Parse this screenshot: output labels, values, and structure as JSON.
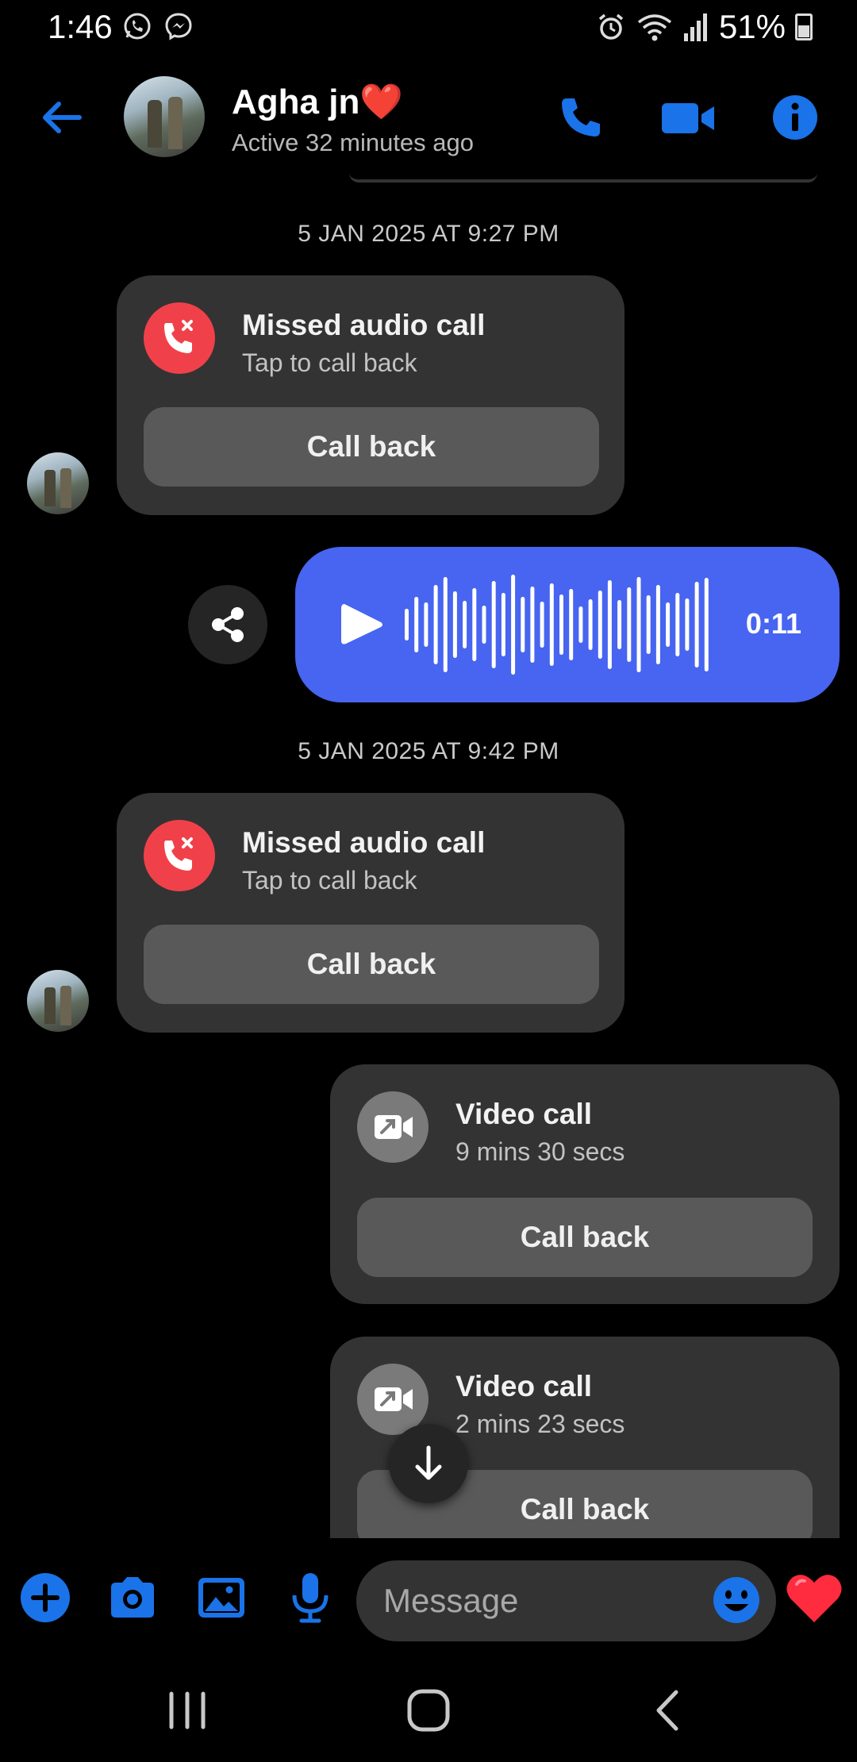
{
  "status_bar": {
    "time": "1:46",
    "battery": "51%",
    "left_icons": [
      "whatsapp-icon",
      "messenger-icon"
    ],
    "right_icons": [
      "alarm-icon",
      "wifi-icon",
      "signal-icon",
      "battery-icon"
    ]
  },
  "header": {
    "contact_name": "Agha jn",
    "contact_emoji": "❤️",
    "status": "Active 32 minutes ago",
    "actions": [
      "back-arrow-icon",
      "phone-icon",
      "video-camera-icon",
      "info-icon"
    ],
    "accent_color": "#1a73e8"
  },
  "messages": {
    "timestamp_1": "5 JAN 2025 AT 9:27 PM",
    "missed_call_1": {
      "title": "Missed audio call",
      "subtitle": "Tap to call back",
      "button": "Call back"
    },
    "voice_message": {
      "duration": "0:11",
      "color": "#4765f0"
    },
    "timestamp_2": "5 JAN 2025 AT 9:42 PM",
    "missed_call_2": {
      "title": "Missed audio call",
      "subtitle": "Tap to call back",
      "button": "Call back"
    },
    "video_call_1": {
      "title": "Video call",
      "subtitle": "9 mins 30 secs",
      "button": "Call back"
    },
    "video_call_2": {
      "title": "Video call",
      "subtitle": "2 mins 23 secs",
      "button": "Call back"
    }
  },
  "composer": {
    "placeholder": "Message",
    "icons": [
      "plus-icon",
      "camera-icon",
      "gallery-icon",
      "microphone-icon",
      "emoji-icon",
      "heart-icon"
    ]
  },
  "nav_bar": [
    "recents-icon",
    "home-icon",
    "back-icon"
  ]
}
